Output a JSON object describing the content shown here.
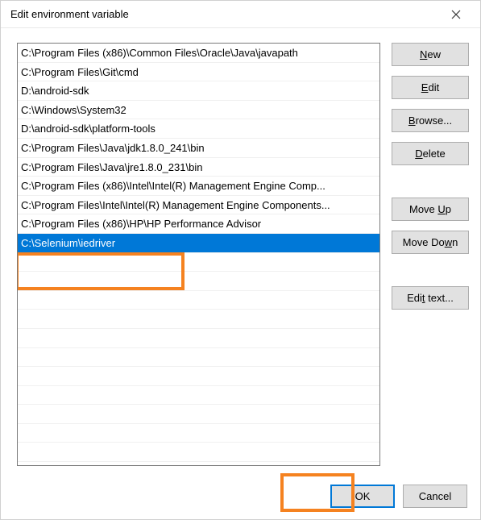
{
  "window": {
    "title": "Edit environment variable"
  },
  "list": {
    "items": [
      {
        "text": "C:\\Program Files (x86)\\Common Files\\Oracle\\Java\\javapath",
        "selected": false
      },
      {
        "text": "C:\\Program Files\\Git\\cmd",
        "selected": false
      },
      {
        "text": "D:\\android-sdk",
        "selected": false
      },
      {
        "text": "C:\\Windows\\System32",
        "selected": false
      },
      {
        "text": "D:\\android-sdk\\platform-tools",
        "selected": false
      },
      {
        "text": "C:\\Program Files\\Java\\jdk1.8.0_241\\bin",
        "selected": false
      },
      {
        "text": "C:\\Program Files\\Java\\jre1.8.0_231\\bin",
        "selected": false
      },
      {
        "text": "C:\\Program Files (x86)\\Intel\\Intel(R) Management Engine Comp...",
        "selected": false
      },
      {
        "text": "C:\\Program Files\\Intel\\Intel(R) Management Engine Components...",
        "selected": false
      },
      {
        "text": "C:\\Program Files (x86)\\HP\\HP Performance Advisor",
        "selected": false
      },
      {
        "text": "C:\\Selenium\\iedriver",
        "selected": true
      }
    ]
  },
  "buttons": {
    "new": "New",
    "edit": "Edit",
    "browse": "Browse...",
    "delete": "Delete",
    "move_up": "Move Up",
    "move_down": "Move Down",
    "edit_text": "Edit text...",
    "ok": "OK",
    "cancel": "Cancel"
  },
  "accel": {
    "new": "N",
    "edit": "E",
    "browse": "B",
    "delete": "D",
    "move_up": "U",
    "move_down": "w",
    "edit_text": "t"
  }
}
